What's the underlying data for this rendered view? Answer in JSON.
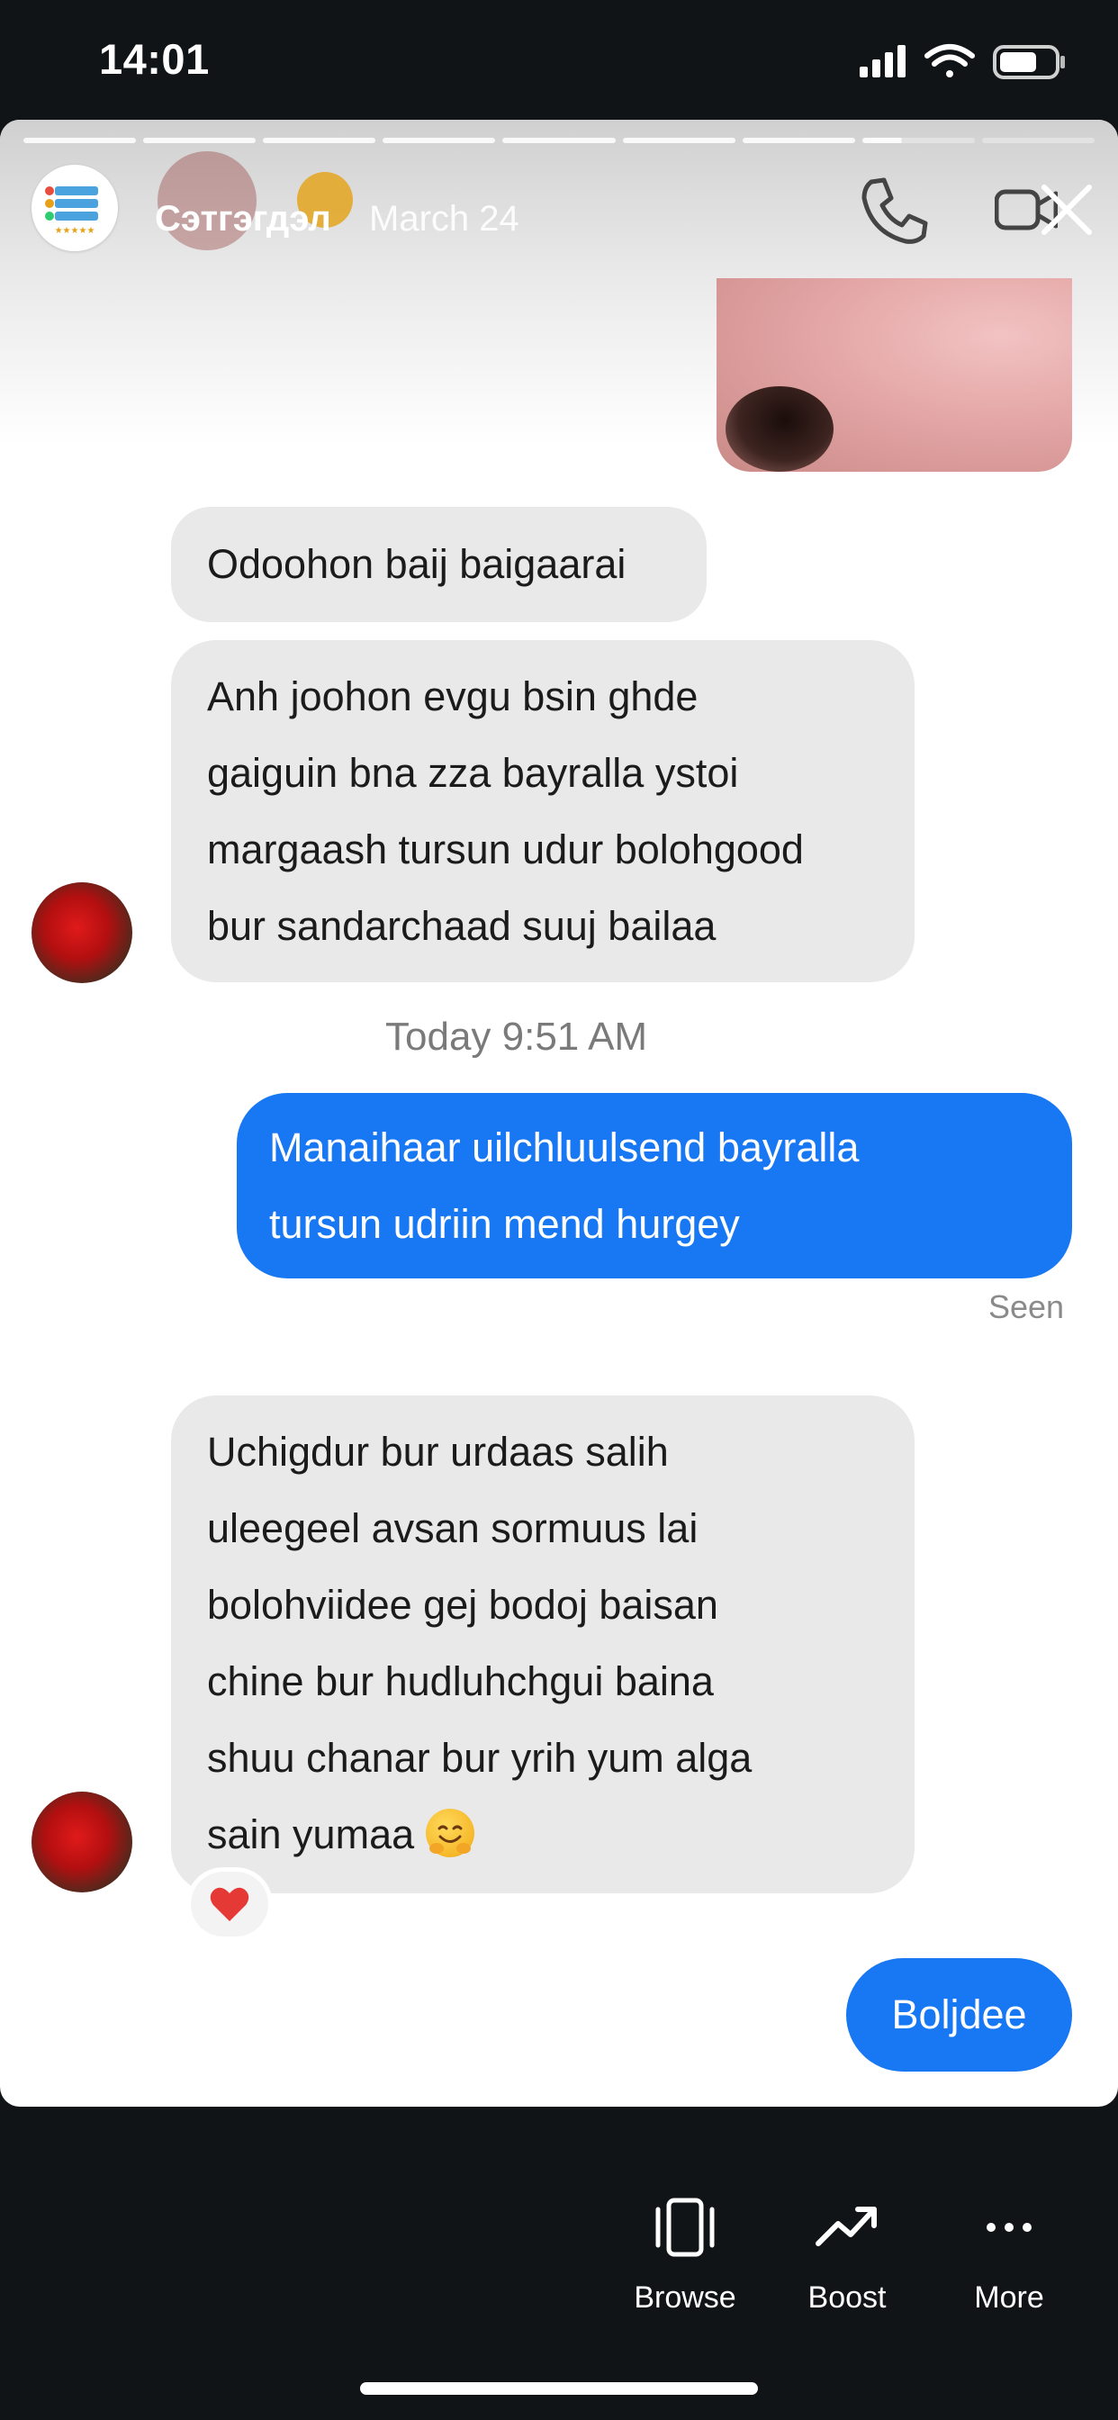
{
  "status_bar": {
    "time": "14:01"
  },
  "story": {
    "user_name": "Сэтгэгдэл",
    "date": "March 24",
    "progress_segments": 9,
    "progress_current_index": 7,
    "icons": [
      "app-logo-icon",
      "phone-icon",
      "video-icon",
      "close-icon"
    ]
  },
  "conversation": {
    "messages": [
      {
        "side": "in",
        "text": "Odoohon baij baigaarai"
      },
      {
        "side": "in",
        "lines": [
          "Anh joohon evgu bsin ghde",
          "gaiguin bna zza bayralla ystoi",
          "margaash tursun udur bolohgood",
          "bur sandarchaad suuj bailaa"
        ]
      },
      {
        "timestamp": "Today 9:51 AM"
      },
      {
        "side": "out",
        "lines": [
          "Manaihaar uilchluulsend bayralla",
          "tursun udriin mend hurgey"
        ],
        "status": "Seen"
      },
      {
        "side": "in",
        "lines": [
          "Uchigdur bur urdaas salih",
          "uleegeel avsan sormuus lai",
          "bolohviidee gej bodoj baisan",
          "chine bur hudluhchgui baina",
          "shuu chanar bur yrih yum alga",
          "sain yumaa"
        ],
        "reaction": "heart-emoji"
      },
      {
        "side": "out",
        "text": "Boljdee"
      }
    ]
  },
  "bottom_bar": {
    "tabs": [
      {
        "label": "Browse",
        "icon": "browse-icon"
      },
      {
        "label": "Boost",
        "icon": "trending-up-icon"
      },
      {
        "label": "More",
        "icon": "more-dots-icon"
      }
    ]
  },
  "colors": {
    "outgoing_bubble": "#1877f2",
    "incoming_bubble": "#e9e9ea",
    "background": "#111417"
  }
}
